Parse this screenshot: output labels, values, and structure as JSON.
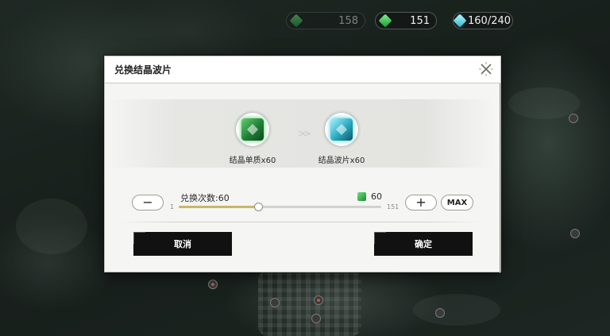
{
  "resources": {
    "item1": {
      "value": "158",
      "icon": "green-leaf-icon"
    },
    "item2": {
      "value": "151",
      "icon": "green-crystal-icon"
    },
    "item3": {
      "value": "160/240",
      "icon": "cyan-crystal-icon"
    }
  },
  "dialog": {
    "title": "兑换结晶波片",
    "source_item": {
      "label": "结晶单质x60",
      "icon": "green-crystal-cube-icon"
    },
    "target_item": {
      "label": "结晶波片x60",
      "icon": "cyan-crystal-cube-icon"
    },
    "arrow": ">>",
    "exchange_count_label": "兑换次数:60",
    "cost_value": "60",
    "slider": {
      "min": "1",
      "max": "151",
      "value": 60
    },
    "minus_label": "−",
    "plus_label": "+",
    "max_label": "MAX",
    "cancel_label": "取消",
    "confirm_label": "确定"
  },
  "colors": {
    "slider_fill": "#c9b865",
    "button_dark": "#111111",
    "dialog_bg": "#f5f5f3"
  }
}
